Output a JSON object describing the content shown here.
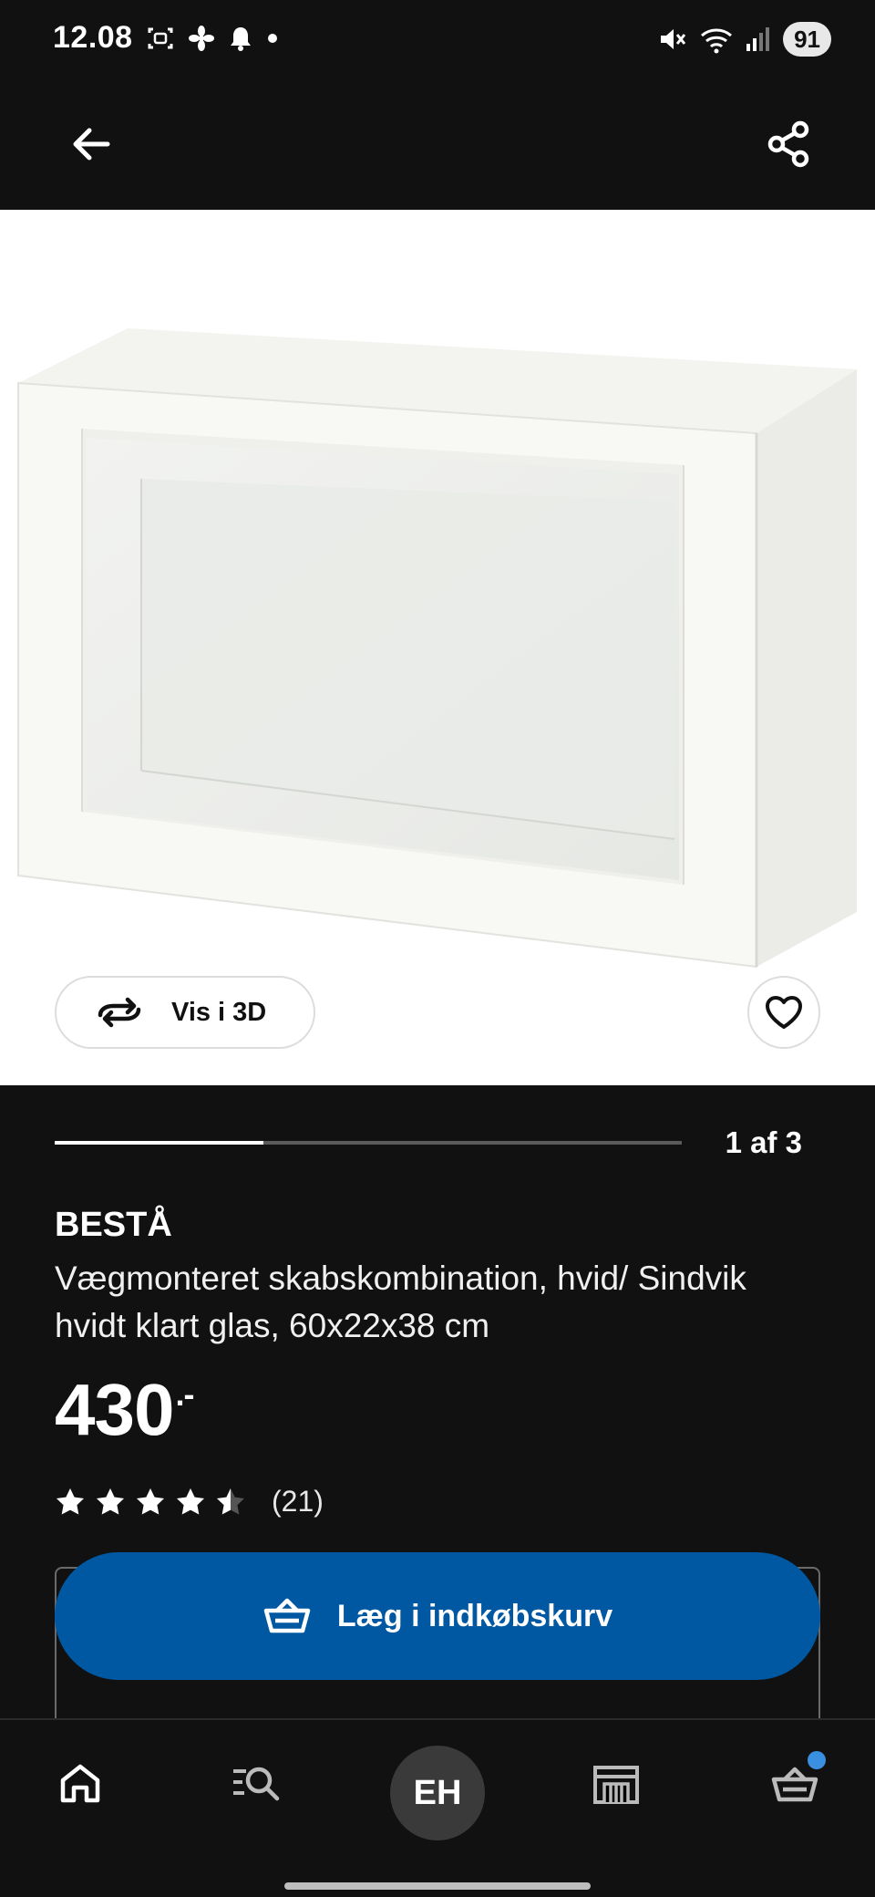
{
  "status_bar": {
    "time": "12.08",
    "battery": "91",
    "icons_left": [
      "screenshot-icon",
      "fan-icon",
      "bell-icon",
      "dot-icon"
    ],
    "icons_right": [
      "mute-icon",
      "wifi-icon",
      "signal-icon"
    ]
  },
  "app_bar": {
    "back_icon": "arrow-left-icon",
    "share_icon": "share-icon"
  },
  "media": {
    "vis3d_label": "Vis i 3D",
    "vis3d_icon": "rotate-3d-icon",
    "favorite_icon": "heart-icon"
  },
  "carousel": {
    "current": 1,
    "total": 3,
    "indicator": "1 af 3"
  },
  "product": {
    "name": "BESTÅ",
    "description": "Vægmonteret skabskombination, hvid/ Sindvik hvidt klart glas, 60x22x38 cm",
    "price": "430",
    "price_suffix": ".-",
    "rating": 4.5,
    "rating_max": 5,
    "review_count": "(21)"
  },
  "cart": {
    "label": "Læg i indkøbskurv",
    "icon": "basket-icon",
    "color": "#0058a3"
  },
  "bottom_nav": {
    "items": [
      "home-icon",
      "search-list-icon",
      "profile",
      "store-icon",
      "basket-icon"
    ],
    "profile_initials": "EH",
    "cart_badge_color": "#3b8fe0"
  }
}
